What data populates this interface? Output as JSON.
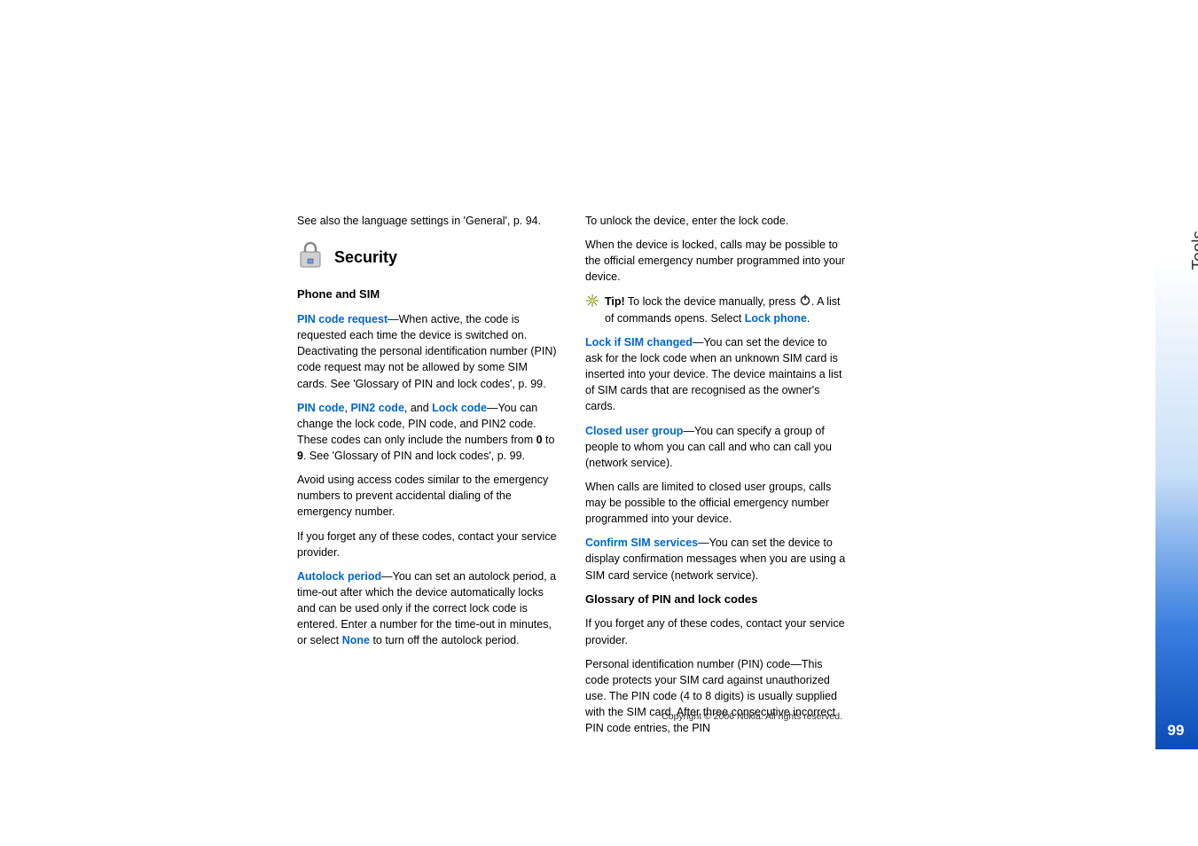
{
  "sideTab": {
    "label": "Tools",
    "pageNumber": "99"
  },
  "copyright": "Copyright © 2006 Nokia. All rights reserved.",
  "leftCol": {
    "langRef": "See also the language settings in 'General', p. 94.",
    "securityHeading": "Security",
    "phoneSimHeading": "Phone and SIM",
    "pinReq": {
      "label": "PIN code request",
      "text": "—When active, the code is requested each time the device is switched on. Deactivating the personal identification number (PIN) code request may not be allowed by some SIM cards. See 'Glossary of PIN and lock codes', p. 99."
    },
    "codes": {
      "pin": "PIN code",
      "sep1": ", ",
      "pin2": "PIN2 code",
      "sep2": ", and ",
      "lock": "Lock code",
      "tail1": "—You can change the lock code, PIN code, and PIN2 code. These codes can only include the numbers from ",
      "zero": "0",
      "to": " to ",
      "nine": "9",
      "tail2": ". See 'Glossary of PIN and lock codes', p. 99."
    },
    "avoid": "Avoid using access codes similar to the emergency numbers to prevent accidental dialing of the emergency number.",
    "forget": "If you forget any of these codes, contact your service provider.",
    "autolock": {
      "label": "Autolock period",
      "text1": "—You can set an autolock period, a time-out after which the device automatically locks and can be used only if the correct lock code is entered. Enter a number for the time-out in minutes, or select ",
      "none": "None",
      "text2": " to turn off the autolock period."
    }
  },
  "rightCol": {
    "unlock": "To unlock the device, enter the lock code.",
    "locked": "When the device is locked, calls may be possible to the official emergency number programmed into your device.",
    "tip": {
      "label": "Tip!",
      "text1": " To lock the device manually, press ",
      "text2": ". A list of commands opens. Select ",
      "lockPhone": "Lock phone",
      "period": "."
    },
    "lockSim": {
      "label": "Lock if SIM changed",
      "text": "—You can set the device to ask for the lock code when an unknown SIM card is inserted into your device. The device maintains a list of SIM cards that are recognised as the owner's cards."
    },
    "closed": {
      "label": "Closed user group",
      "text": "—You can specify a group of people to whom you can call and who can call you (network service)."
    },
    "closedNote": "When calls are limited to closed user groups, calls may be possible to the official emergency number programmed into your device.",
    "confirm": {
      "label": "Confirm SIM services",
      "text": "—You can set the device to display confirmation messages when you are using a SIM card service (network service)."
    },
    "glossaryHeading": "Glossary of PIN and lock codes",
    "glossaryForget": "If you forget any of these codes, contact your service provider.",
    "pinDesc": "Personal identification number (PIN) code—This code protects your SIM card against unauthorized use. The PIN code (4 to 8 digits) is usually supplied with the SIM card. After three consecutive incorrect PIN code entries, the PIN"
  },
  "icons": {
    "lock": "lock-icon",
    "tipStar": "tip-star-icon",
    "power": "power-icon"
  }
}
